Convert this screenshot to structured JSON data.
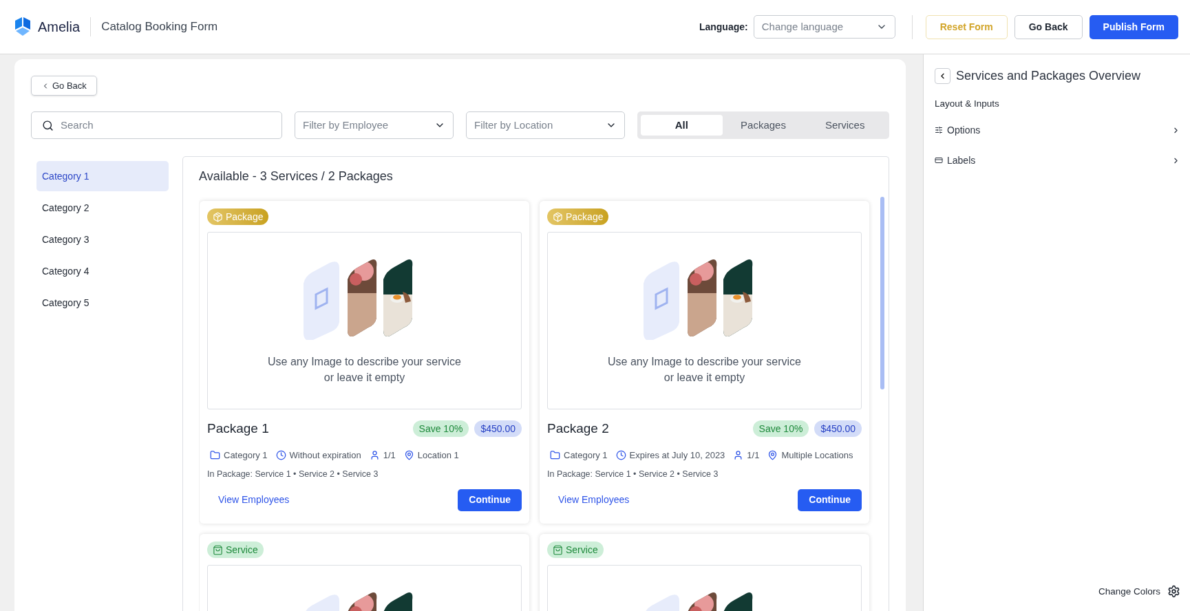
{
  "header": {
    "logo_text": "Amelia",
    "title": "Catalog Booking Form",
    "language_label": "Language:",
    "language_placeholder": "Change language",
    "buttons": [
      {
        "label": "Reset Form",
        "kind": "reset"
      },
      {
        "label": "Go Back",
        "kind": "outline"
      },
      {
        "label": "Publish Form",
        "kind": "primary"
      }
    ]
  },
  "go_back": "Go Back",
  "search": {
    "placeholder": "Search"
  },
  "filters": [
    {
      "placeholder": "Filter by Employee"
    },
    {
      "placeholder": "Filter by Location"
    }
  ],
  "view_tabs": [
    {
      "label": "All",
      "selected": true
    },
    {
      "label": "Packages",
      "selected": false
    },
    {
      "label": "Services",
      "selected": false
    }
  ],
  "categories": [
    {
      "label": "Category 1",
      "selected": true
    },
    {
      "label": "Category 2",
      "selected": false
    },
    {
      "label": "Category 3",
      "selected": false
    },
    {
      "label": "Category 4",
      "selected": false
    },
    {
      "label": "Category 5",
      "selected": false
    }
  ],
  "available_title": "Available - 3 Services / 2 Packages",
  "cards": [
    {
      "kind": "package",
      "badge": "Package",
      "hint": "Use any Image to describe your service or leave it empty",
      "title": "Package 1",
      "save": "Save 10%",
      "price": "$450.00",
      "meta": [
        {
          "kind": "folder",
          "text": "Category 1"
        },
        {
          "kind": "clock",
          "text": "Without expiration"
        },
        {
          "kind": "user",
          "text": "1/1"
        },
        {
          "kind": "pin",
          "text": "Location 1"
        }
      ],
      "in_package": "In Package: Service 1 • Service 2 • Service 3",
      "view_link": "View Employees",
      "continue": "Continue"
    },
    {
      "kind": "package",
      "badge": "Package",
      "hint": "Use any Image to describe your service or leave it empty",
      "title": "Package 2",
      "save": "Save 10%",
      "price": "$450.00",
      "meta": [
        {
          "kind": "folder",
          "text": "Category 1"
        },
        {
          "kind": "clock",
          "text": "Expires at July 10, 2023"
        },
        {
          "kind": "user",
          "text": "1/1"
        },
        {
          "kind": "pin",
          "text": "Multiple Locations"
        }
      ],
      "in_package": "In Package: Service 1 • Service 2 • Service 3",
      "view_link": "View Employees",
      "continue": "Continue"
    },
    {
      "kind": "service",
      "badge": "Service"
    },
    {
      "kind": "service",
      "badge": "Service"
    }
  ],
  "panel": {
    "title": "Services and Packages Overview",
    "section": "Layout & Inputs",
    "items": [
      {
        "kind": "options",
        "label": "Options"
      },
      {
        "kind": "labels",
        "label": "Labels"
      }
    ],
    "change_colors": "Change Colors"
  }
}
